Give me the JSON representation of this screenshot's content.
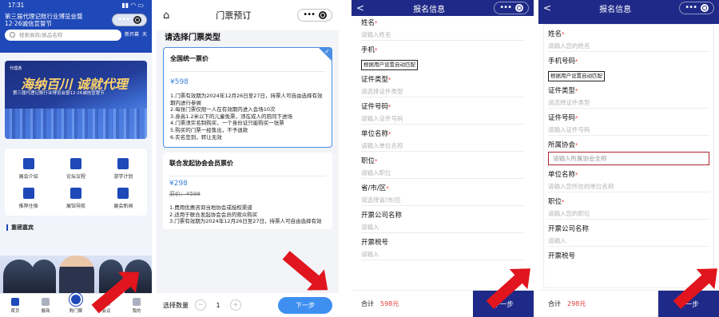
{
  "panel1": {
    "status_time": "17:31",
    "title_line1": "第三届代理记账行业博览会暨",
    "title_line2": "12·26诚信宣誓节",
    "search_placeholder": "搜索展商/展品名称",
    "side_text_1": "新开幕",
    "side_text_2": "天",
    "banner_logo": "代理通",
    "banner_slogan": "海纳百川 诚就代理",
    "banner_sub": "第三届代理记账行业博览会暨12·26诚信宣誓节",
    "grid_items": [
      {
        "label": "展会介绍",
        "icon": "building-icon"
      },
      {
        "label": "论坛议程",
        "icon": "calendar-icon"
      },
      {
        "label": "游学计划",
        "icon": "graduation-cap-icon"
      },
      {
        "label": "推荐住宿",
        "icon": "hotel-icon"
      },
      {
        "label": "展馆导航",
        "icon": "museum-icon"
      },
      {
        "label": "展会新闻",
        "icon": "globe-icon"
      }
    ],
    "guest_heading": "重磅嘉宾",
    "tabs": [
      {
        "label": "首页",
        "icon": "home-icon"
      },
      {
        "label": "展商",
        "icon": "exhibitor-icon"
      },
      {
        "label": "购门票",
        "icon": "ticket-icon"
      },
      {
        "label": "会议",
        "icon": "meeting-icon"
      },
      {
        "label": "我的",
        "icon": "profile-icon"
      }
    ]
  },
  "panel2": {
    "home_icon": "⌂",
    "title": "门票预订",
    "section_title": "请选择门票类型",
    "card1": {
      "name": "全国统一票价",
      "price": "¥598",
      "desc": [
        "1.门票有效期为2024年12月26日至27日，持票人可自由选择有效期内进行参展",
        "2.每张门票仅限一人在有效期内进入会场10次",
        "3.身高1.2米以下的儿童免票，须在成人的陪同下进场",
        "4.门票须实名制购买，一个身份证只能购买一张票",
        "5.购买的门票一经售出，不予退款",
        "6.实名签到，转让无效"
      ]
    },
    "card2": {
      "name": "联合发起协会会员票价",
      "price": "¥298",
      "orig_price": "原价：¥598",
      "desc": [
        "1.费用优惠咨询当地协会或授权渠道",
        "2.适用于联合发起协会会员的观众购买",
        "3.门票有效期为2024年12月26日至27日，持票人可自由选择有效"
      ]
    },
    "qty_label": "选择数量",
    "minus": "−",
    "qty": "1",
    "plus": "+",
    "next_label": "下一步"
  },
  "panel3": {
    "title": "报名信息",
    "back": "<",
    "fields": [
      {
        "label": "姓名",
        "placeholder": "请输入姓名"
      },
      {
        "label": "手机",
        "placeholder": "根据用户设置自动匹配"
      },
      {
        "label": "证件类型",
        "placeholder": "请选择证件类型"
      },
      {
        "label": "证件号码",
        "placeholder": "请输入证件号码"
      },
      {
        "label": "单位名称",
        "placeholder": "请输入单位名称"
      },
      {
        "label": "职位",
        "placeholder": "请输入职位"
      },
      {
        "label": "省/市/区",
        "placeholder": "请选择省/市/区"
      },
      {
        "label": "开票公司名称",
        "placeholder": "请输入"
      },
      {
        "label": "开票税号",
        "placeholder": "请输入"
      }
    ],
    "total_label": "合计",
    "total_value": "598元",
    "next_label": "下一步"
  },
  "panel4": {
    "title": "报名信息",
    "back": "<",
    "fields": [
      {
        "label": "姓名",
        "placeholder": "请输入您的姓名"
      },
      {
        "label": "手机号码",
        "placeholder": "根据用户设置自动匹配"
      },
      {
        "label": "证件类型",
        "placeholder": "请选择证件类型"
      },
      {
        "label": "证件号码",
        "placeholder": "请输入证件号码"
      },
      {
        "label": "所属协会",
        "placeholder": "请输入所属协会全称"
      },
      {
        "label": "单位名称",
        "placeholder": "请输入您所在的单位名称"
      },
      {
        "label": "职位",
        "placeholder": "请输入您的职位"
      },
      {
        "label": "开票公司名称",
        "placeholder": "请输入"
      },
      {
        "label": "开票税号",
        "placeholder": ""
      }
    ],
    "total_label": "合计",
    "total_value": "298元",
    "next_label": "下一步"
  },
  "colors": {
    "brand_blue": "#1f49b8",
    "form_navy": "#1f2a88",
    "select_blue": "#4a8fe4",
    "arrow_red": "#e0151d"
  }
}
